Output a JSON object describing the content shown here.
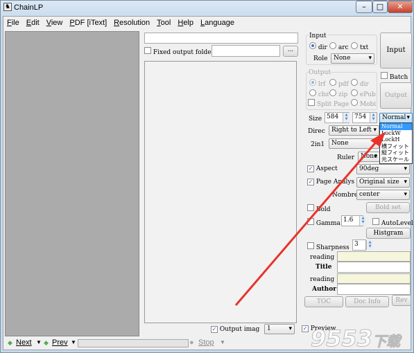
{
  "window": {
    "title": "ChainLP",
    "minimize": "–",
    "maximize": "□",
    "close": "✕"
  },
  "menu": [
    "File",
    "Edit",
    "View",
    "PDF [iText]",
    "Resolution",
    "Tool",
    "Help",
    "Language"
  ],
  "middle": {
    "top_field": "",
    "fixed_output_label": "Fixed output folde",
    "fixed_output_value": "",
    "browse_label": "...",
    "output_image_label": "Output imag",
    "output_image_checked": true,
    "output_image_value": "1"
  },
  "input": {
    "group_label": "Input",
    "options": [
      "dir",
      "arc",
      "txt"
    ],
    "selected": "dir",
    "role_label": "Role",
    "role_value": "None",
    "input_button": "Input"
  },
  "output": {
    "group_label": "Output",
    "options": [
      "lrf",
      "pdf",
      "dir",
      "cbz",
      "zip",
      "ePub",
      "Mobi"
    ],
    "selected": "lrf",
    "split_page": "Split Page",
    "batch_label": "Batch",
    "output_button": "Output"
  },
  "size": {
    "label": "Size",
    "width": "584",
    "height": "754",
    "mode": "Normal",
    "mode_options": [
      "Normal",
      "LockW",
      "LockH",
      "横フィット",
      "縦フィット",
      "元スケール"
    ]
  },
  "direc": {
    "label": "Direc",
    "value": "Right to Left"
  },
  "twoin1": {
    "label": "2in1",
    "value": "None"
  },
  "ruler": {
    "label": "Ruler",
    "value": "None"
  },
  "aspect": {
    "label": "Aspect",
    "checked": true,
    "value": "90deg"
  },
  "page_analysis": {
    "label": "Page Analys",
    "checked": true,
    "value": "Original size"
  },
  "nombre": {
    "label": "Nombre",
    "value": "center"
  },
  "bold": {
    "label": "Bold",
    "checked": false,
    "button": "Bold set"
  },
  "gamma": {
    "label": "Gamma",
    "checked": false,
    "value": "1.6",
    "autolevel": "AutoLevel",
    "histgram": "Histgram"
  },
  "sharpness": {
    "label": "Sharpness",
    "checked": false,
    "value": "3"
  },
  "meta": {
    "reading1": "reading",
    "title": "Title",
    "reading2": "reading",
    "author": "Author",
    "toc": "TOC",
    "docinfo": "Doc Info",
    "rev": "Rev"
  },
  "preview": {
    "label": "Preview",
    "checked": true
  },
  "status": {
    "next": "Next",
    "prev": "Prev",
    "stop": "Stop"
  },
  "watermark": "9553下载 .com",
  "colors": {
    "annotation_arrow": "#e8332a",
    "selected": "#3399ff"
  }
}
